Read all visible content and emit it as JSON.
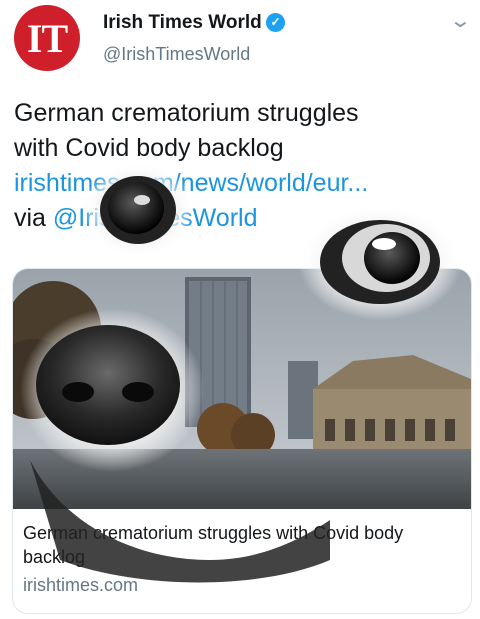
{
  "account": {
    "avatar_text": "IT",
    "display_name": "Irish Times World",
    "handle": "@IrishTimesWorld",
    "verified_icon": "verified-check-icon",
    "menu_icon": "chevron-down-icon"
  },
  "tweet": {
    "text_line1": "German crematorium struggles",
    "text_line2": "with Covid body backlog",
    "link": "irishtimes.com/news/world/eur...",
    "via": "via ",
    "via_handle": "@IrishTimesWorld"
  },
  "card": {
    "title": "German crematorium struggles with Covid body backlog",
    "domain": "irishtimes.com"
  },
  "colors": {
    "avatar_red": "#cf1f2a",
    "link_blue": "#1b95e0",
    "secondary_gray": "#657786"
  }
}
